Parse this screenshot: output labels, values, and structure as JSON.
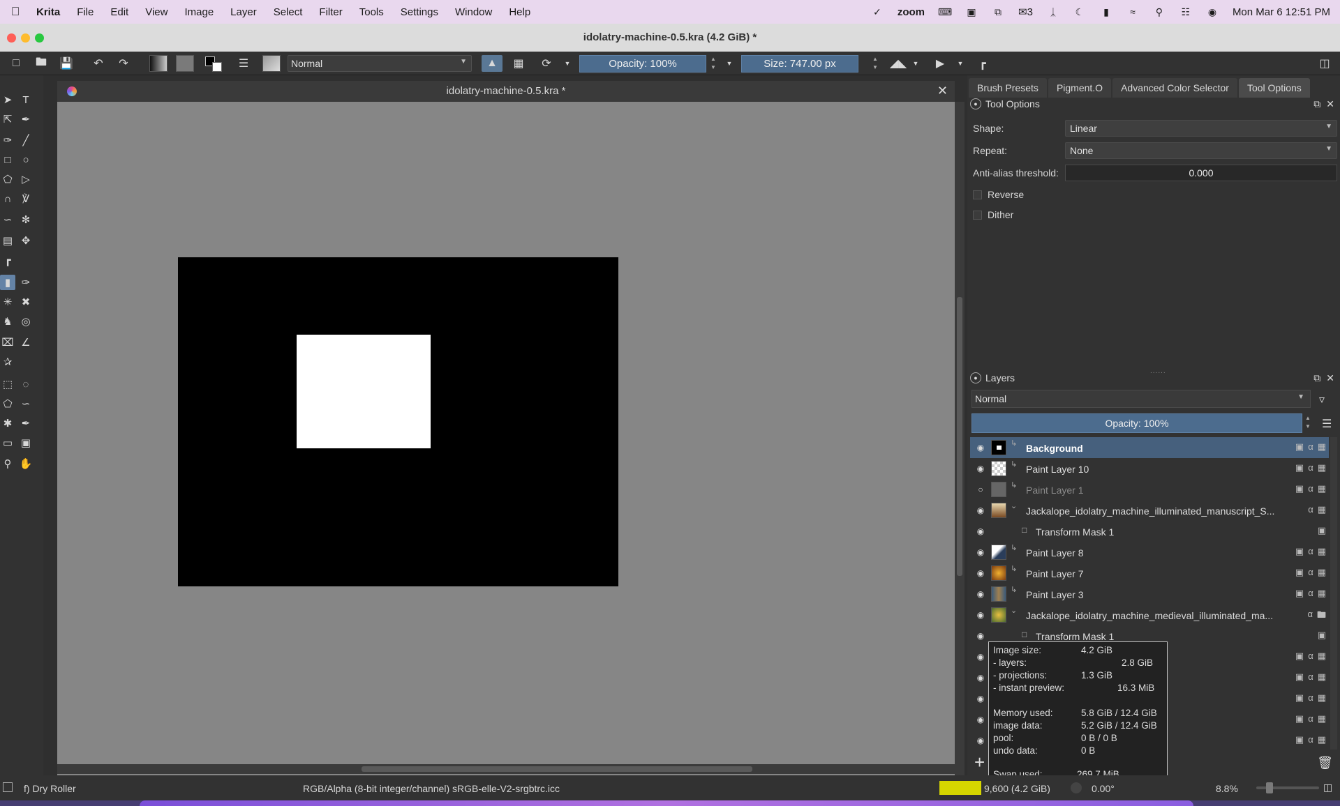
{
  "mac_menubar": {
    "app_name": "Krita",
    "menus": [
      "File",
      "Edit",
      "View",
      "Image",
      "Layer",
      "Select",
      "Filter",
      "Tools",
      "Settings",
      "Window",
      "Help"
    ],
    "status": {
      "zoom_label": "zoom",
      "notifications_count": "3",
      "datetime": "Mon Mar 6  12:51 PM"
    }
  },
  "window": {
    "title": "idolatry-machine-0.5.kra (4.2 GiB)  *",
    "traffic_colors": [
      "#fe5f57",
      "#febc2e",
      "#28c840"
    ]
  },
  "toolbar": {
    "blend_mode": "Normal",
    "opacity_label": "Opacity: 100%",
    "size_label": "Size: 747.00 px"
  },
  "document": {
    "tab_title": "idolatry-machine-0.5.kra *"
  },
  "dock_tabs": [
    "Brush Presets",
    "Pigment.O",
    "Advanced Color Selector",
    "Tool Options"
  ],
  "tool_options": {
    "panel_title": "Tool Options",
    "shape_label": "Shape:",
    "shape_value": "Linear",
    "repeat_label": "Repeat:",
    "repeat_value": "None",
    "antialias_label": "Anti-alias threshold:",
    "antialias_value": "0.000",
    "reverse_label": "Reverse",
    "dither_label": "Dither"
  },
  "layers": {
    "panel_title": "Layers",
    "blend_mode": "Normal",
    "opacity_label": "Opacity:  100%",
    "rows": [
      {
        "name": "Background",
        "selected": true,
        "visible": true
      },
      {
        "name": "Paint Layer 10",
        "visible": true
      },
      {
        "name": "Paint Layer 1",
        "visible": false
      },
      {
        "name": "Jackalope_idolatry_machine_illuminated_manuscript_S...",
        "visible": true,
        "group": true
      },
      {
        "name": "Transform Mask 1",
        "visible": true,
        "mask": true
      },
      {
        "name": "Paint Layer 8",
        "visible": true
      },
      {
        "name": "Paint Layer 7",
        "visible": true
      },
      {
        "name": "Paint Layer 3",
        "visible": true
      },
      {
        "name": "Jackalope_idolatry_machine_medieval_illuminated_ma...",
        "visible": true,
        "group": true
      },
      {
        "name": "Transform Mask 1",
        "visible": true,
        "mask": true
      }
    ]
  },
  "memory_tooltip": {
    "image_size_label": "Image size:",
    "image_size": "4.2 GiB",
    "layers_label": " - layers:",
    "layers": "2.8 GiB",
    "projections_label": " - projections:",
    "projections": "1.3 GiB",
    "instant_label": " - instant preview:",
    "instant": "16.3 MiB",
    "memory_used_label": "Memory used:",
    "memory_used": "5.8 GiB / 12.4 GiB",
    "image_data_label": " image data:",
    "image_data": "5.2 GiB / 12.4 GiB",
    "pool_label": " pool:",
    "pool": "0 B / 0 B",
    "undo_label": " undo data:",
    "undo": "0 B",
    "swap_label": "Swap used:",
    "swap": "269.7 MiB"
  },
  "statusbar": {
    "brush_preset": "f) Dry Roller",
    "color_space": "RGB/Alpha (8-bit integer/channel)  sRGB-elle-V2-srgbtrc.icc",
    "memory": "9,600 (4.2 GiB)",
    "rotation": "0.00°",
    "zoom": "8.8%"
  }
}
